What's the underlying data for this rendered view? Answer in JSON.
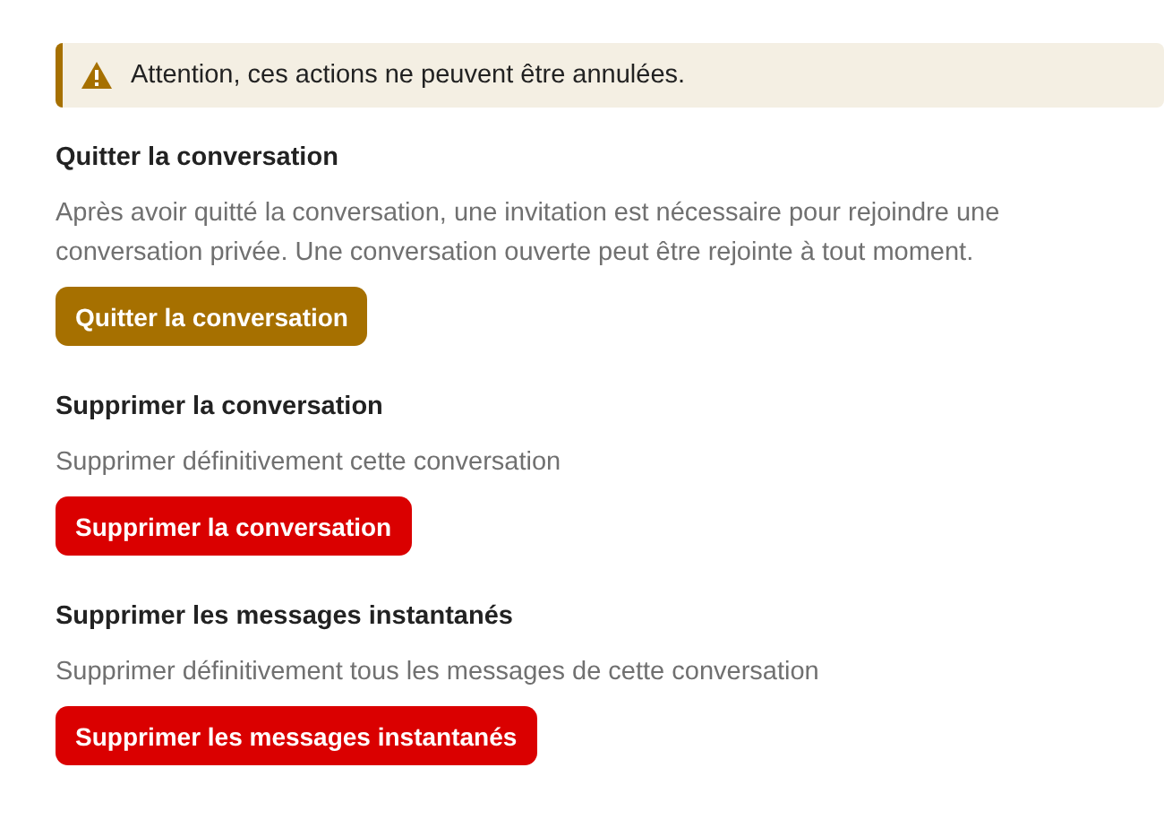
{
  "warning": {
    "text": "Attention, ces actions ne peuvent être annulées."
  },
  "sections": [
    {
      "title": "Quitter la conversation",
      "description": "Après avoir quitté la conversation, une invitation est nécessaire pour rejoindre une conversation privée. Une conversation ouverte peut être rejointe à tout moment.",
      "button": {
        "label": "Quitter la conversation",
        "kind": "warning"
      }
    },
    {
      "title": "Supprimer la conversation",
      "description": "Supprimer définitivement cette conversation",
      "button": {
        "label": "Supprimer la conversation",
        "kind": "danger"
      }
    },
    {
      "title": "Supprimer les messages instantanés",
      "description": "Supprimer définitivement tous les messages de cette conversation",
      "button": {
        "label": "Supprimer les messages instantanés",
        "kind": "danger"
      }
    }
  ]
}
